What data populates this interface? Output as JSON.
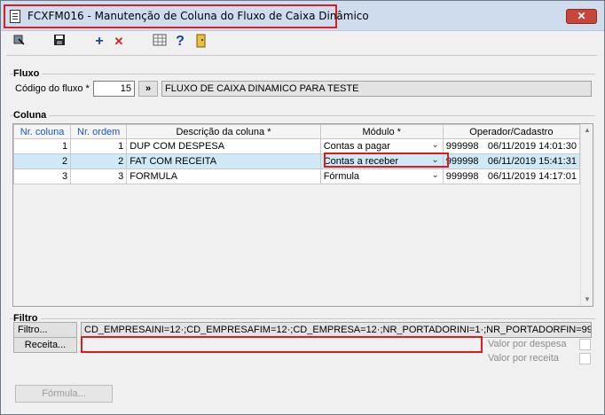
{
  "window": {
    "title": "FCXFM016 - Manutenção de Coluna do Fluxo de Caixa Dinâmico",
    "close_glyph": "✕"
  },
  "toolbar": {
    "icons": [
      "pointer-icon",
      "save-icon",
      "add-icon",
      "delete-icon",
      "grid-icon",
      "help-icon",
      "exit-icon"
    ],
    "add_glyph": "+",
    "delete_glyph": "✕",
    "help_glyph": "?"
  },
  "fluxo": {
    "group_label": "Fluxo",
    "code_label": "Código do fluxo *",
    "code_value": "15",
    "lookup_label": "»",
    "description": "FLUXO DE CAIXA DINAMICO PARA TESTE"
  },
  "coluna": {
    "group_label": "Coluna",
    "headers": [
      "Nr. coluna",
      "Nr. ordem",
      "Descrição da coluna *",
      "Módulo *",
      "Operador/Cadastro"
    ],
    "rows": [
      {
        "nr_coluna": "1",
        "nr_ordem": "1",
        "descricao": "DUP COM DESPESA",
        "modulo": "Contas a pagar",
        "operador": "999998",
        "cadastro": "06/11/2019 14:01:30"
      },
      {
        "nr_coluna": "2",
        "nr_ordem": "2",
        "descricao": "FAT COM RECEITA",
        "modulo": "Contas a receber",
        "operador": "999998",
        "cadastro": "06/11/2019 15:41:31"
      },
      {
        "nr_coluna": "3",
        "nr_ordem": "3",
        "descricao": "FORMULA",
        "modulo": "Fórmula",
        "operador": "999998",
        "cadastro": "06/11/2019 14:17:01"
      }
    ],
    "selected_row_index": 1
  },
  "filtro": {
    "group_label": "Filtro",
    "filtro_button": "Filtro...",
    "filtro_value": "CD_EMPRESAINI=12·;CD_EMPRESAFIM=12·;CD_EMPRESA=12·;NR_PORTADORINI=1·;NR_PORTADORFIN=9999·;NR_PO",
    "receita_button": "Receita...",
    "receita_value": "",
    "valor_despesa_label": "Valor por despesa",
    "valor_despesa_checked": false,
    "valor_receita_label": "Valor por receita",
    "valor_receita_checked": false
  },
  "formula_button": "Fórmula...",
  "colors": {
    "titlebar": "#cfdcee",
    "highlight": "#d42020",
    "selected_row": "#cfe9f7",
    "header_text": "#1c55b8"
  }
}
